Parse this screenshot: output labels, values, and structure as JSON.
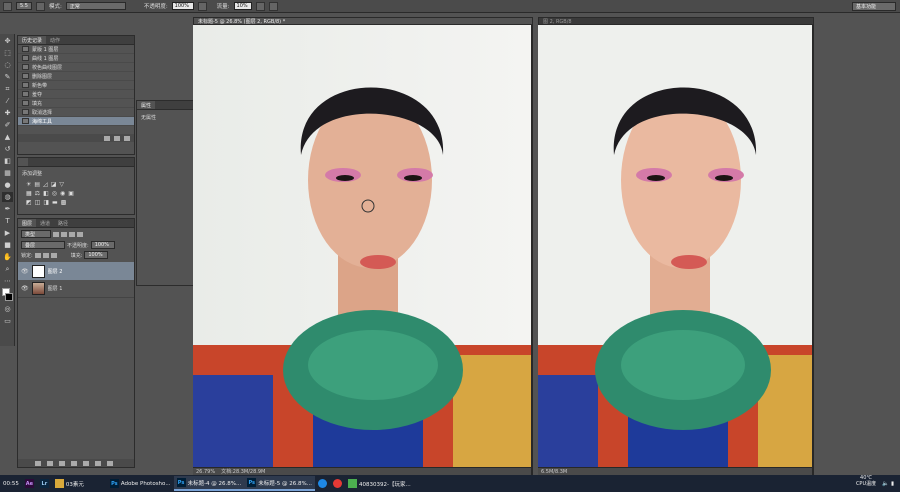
{
  "options_bar": {
    "brush_size": "5.5",
    "mode_label": "模式:",
    "mode_value": "正常",
    "opacity_label": "不透明度:",
    "opacity_value": "100%",
    "flow_label": "流量:",
    "flow_value": "10%",
    "workspace": "基本功能"
  },
  "history_panel": {
    "tabs": [
      "历史记录",
      "动作"
    ],
    "items": [
      "蒙版 1 图层",
      "曲线 1 图层",
      "校色曲线图层",
      "删除图层",
      "新色带",
      "羞夺",
      "填充",
      "取消选择",
      "海绵工具"
    ]
  },
  "properties_panel": {
    "title": "属性",
    "content": "无属性"
  },
  "adjustments_panel": {
    "title": "添加调整"
  },
  "layers_panel": {
    "tabs": [
      "图层",
      "通道",
      "路径"
    ],
    "kind": "类型",
    "blend": "叠层",
    "opacity_label": "不透明度:",
    "opacity_value": "100%",
    "lock_label": "锁定:",
    "fill_label": "填充:",
    "fill_value": "100%",
    "layers": [
      {
        "name": "图层 2",
        "selected": true
      },
      {
        "name": "图层 1",
        "selected": false
      }
    ]
  },
  "documents": [
    {
      "tab": "未标题-5 @ 26.8% (图层 2, RGB/8) *",
      "zoom": "26.79%",
      "info": "文档:28.3M/28.9M"
    },
    {
      "tab": "图 2, RGB/8",
      "zoom": "",
      "info": "6.5M/8.3M"
    }
  ],
  "taskbar": {
    "time": "00:55",
    "items": [
      {
        "icon": "Ae",
        "label": ""
      },
      {
        "icon": "Lr",
        "label": ""
      },
      {
        "icon": "",
        "label": "03素元"
      },
      {
        "icon": "Ps",
        "label": "Adobe Photosho..."
      },
      {
        "icon": "Ps",
        "label": "未标题-4 @ 26.8%..."
      },
      {
        "icon": "Ps",
        "label": "未标题-5 @ 26.8%..."
      },
      {
        "icon": "",
        "label": "40830392-【玩家..."
      }
    ],
    "temperature": "40℃",
    "cpu": "CPU温度"
  },
  "colors": {
    "accent_selected": "#7a8796",
    "taskbar": "#1a2333",
    "ps_blue": "#2fa3f7"
  }
}
